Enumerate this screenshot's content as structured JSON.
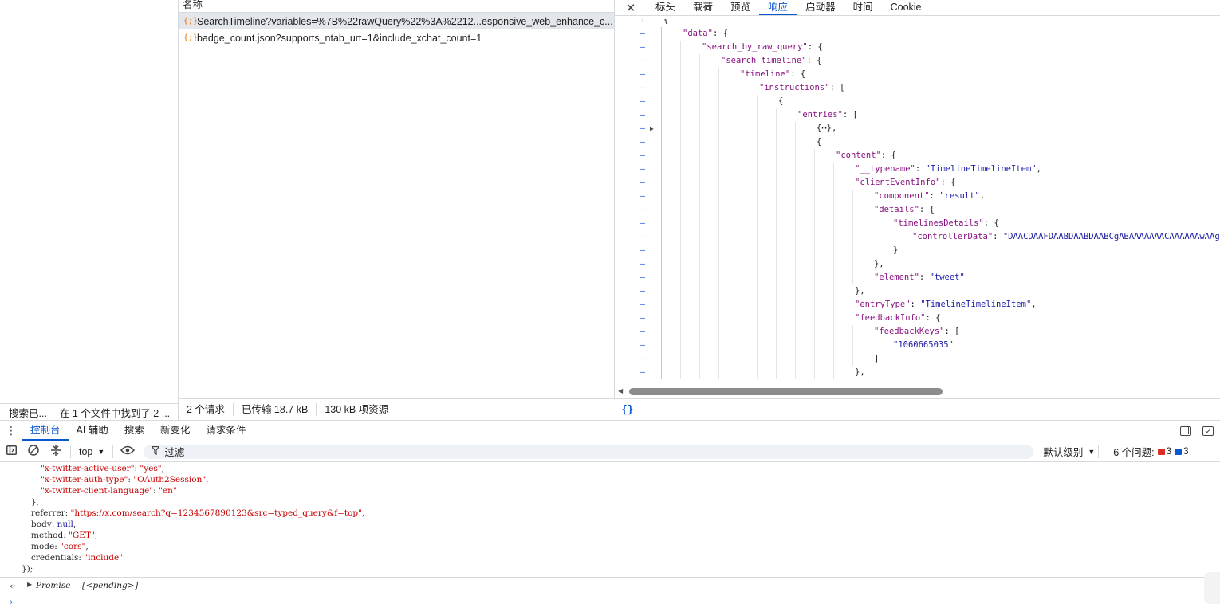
{
  "search_panel": {
    "status_left": "搜索已...",
    "status_right": "在 1 个文件中找到了 2 ..."
  },
  "network": {
    "column_name": "名称",
    "requests": [
      {
        "name": "SearchTimeline?variables=%7B%22rawQuery%22%3A%2212...esponsive_web_enhance_c...",
        "icon": "json-braces-icon",
        "selected": true
      },
      {
        "name": "badge_count.json?supports_ntab_urt=1&include_xchat_count=1",
        "icon": "json-braces-icon",
        "selected": false
      }
    ],
    "status": {
      "requests": "2 个请求",
      "transferred": "已传输 18.7 kB",
      "resources": "130 kB 项资源"
    }
  },
  "detail": {
    "close_label": "✕",
    "tabs": [
      "标头",
      "载荷",
      "预览",
      "响应",
      "启动器",
      "时间",
      "Cookie"
    ],
    "active_tab": "响应",
    "pretty_print_label": "{}",
    "lines": [
      {
        "num": "1",
        "indent": 0,
        "text": "{",
        "tokens": [
          {
            "t": "{",
            "c": "p"
          }
        ]
      },
      {
        "num": "–",
        "indent": 1,
        "tokens": [
          {
            "t": "\"data\"",
            "c": "k"
          },
          {
            "t": ": {",
            "c": "p"
          }
        ]
      },
      {
        "num": "–",
        "indent": 2,
        "tokens": [
          {
            "t": "\"search_by_raw_query\"",
            "c": "k"
          },
          {
            "t": ": {",
            "c": "p"
          }
        ]
      },
      {
        "num": "–",
        "indent": 3,
        "tokens": [
          {
            "t": "\"search_timeline\"",
            "c": "k"
          },
          {
            "t": ": {",
            "c": "p"
          }
        ]
      },
      {
        "num": "–",
        "indent": 4,
        "tokens": [
          {
            "t": "\"timeline\"",
            "c": "k"
          },
          {
            "t": ": {",
            "c": "p"
          }
        ]
      },
      {
        "num": "–",
        "indent": 5,
        "tokens": [
          {
            "t": "\"instructions\"",
            "c": "k"
          },
          {
            "t": ": [",
            "c": "p"
          }
        ]
      },
      {
        "num": "–",
        "indent": 6,
        "tokens": [
          {
            "t": "{",
            "c": "p"
          }
        ]
      },
      {
        "num": "–",
        "indent": 7,
        "tokens": [
          {
            "t": "\"entries\"",
            "c": "k"
          },
          {
            "t": ": [",
            "c": "p"
          }
        ]
      },
      {
        "num": "–",
        "indent": 8,
        "collapsed": true,
        "tokens": [
          {
            "t": "{⋯},",
            "c": "p"
          }
        ]
      },
      {
        "num": "–",
        "indent": 8,
        "tokens": [
          {
            "t": "{",
            "c": "p"
          }
        ]
      },
      {
        "num": "–",
        "indent": 9,
        "tokens": [
          {
            "t": "\"content\"",
            "c": "k"
          },
          {
            "t": ": {",
            "c": "p"
          }
        ]
      },
      {
        "num": "–",
        "indent": 10,
        "tokens": [
          {
            "t": "\"__typename\"",
            "c": "k"
          },
          {
            "t": ": ",
            "c": "p"
          },
          {
            "t": "\"TimelineTimelineItem\"",
            "c": "s"
          },
          {
            "t": ",",
            "c": "p"
          }
        ]
      },
      {
        "num": "–",
        "indent": 10,
        "tokens": [
          {
            "t": "\"clientEventInfo\"",
            "c": "k"
          },
          {
            "t": ": {",
            "c": "p"
          }
        ]
      },
      {
        "num": "–",
        "indent": 11,
        "tokens": [
          {
            "t": "\"component\"",
            "c": "k"
          },
          {
            "t": ": ",
            "c": "p"
          },
          {
            "t": "\"result\"",
            "c": "s"
          },
          {
            "t": ",",
            "c": "p"
          }
        ]
      },
      {
        "num": "–",
        "indent": 11,
        "tokens": [
          {
            "t": "\"details\"",
            "c": "k"
          },
          {
            "t": ": {",
            "c": "p"
          }
        ]
      },
      {
        "num": "–",
        "indent": 12,
        "tokens": [
          {
            "t": "\"timelinesDetails\"",
            "c": "k"
          },
          {
            "t": ": {",
            "c": "p"
          }
        ]
      },
      {
        "num": "–",
        "indent": 13,
        "tokens": [
          {
            "t": "\"controllerData\"",
            "c": "k"
          },
          {
            "t": ": ",
            "c": "p"
          },
          {
            "t": "\"DAACDAAFDAABDAABDAABCgABAAAAAAACAAAAAAwAAgoAAQ",
            "c": "s"
          }
        ]
      },
      {
        "num": "–",
        "indent": 12,
        "tokens": [
          {
            "t": "}",
            "c": "p"
          }
        ]
      },
      {
        "num": "–",
        "indent": 11,
        "tokens": [
          {
            "t": "},",
            "c": "p"
          }
        ]
      },
      {
        "num": "–",
        "indent": 11,
        "tokens": [
          {
            "t": "\"element\"",
            "c": "k"
          },
          {
            "t": ": ",
            "c": "p"
          },
          {
            "t": "\"tweet\"",
            "c": "s"
          }
        ]
      },
      {
        "num": "–",
        "indent": 10,
        "tokens": [
          {
            "t": "},",
            "c": "p"
          }
        ]
      },
      {
        "num": "–",
        "indent": 10,
        "tokens": [
          {
            "t": "\"entryType\"",
            "c": "k"
          },
          {
            "t": ": ",
            "c": "p"
          },
          {
            "t": "\"TimelineTimelineItem\"",
            "c": "s"
          },
          {
            "t": ",",
            "c": "p"
          }
        ]
      },
      {
        "num": "–",
        "indent": 10,
        "tokens": [
          {
            "t": "\"feedbackInfo\"",
            "c": "k"
          },
          {
            "t": ": {",
            "c": "p"
          }
        ]
      },
      {
        "num": "–",
        "indent": 11,
        "tokens": [
          {
            "t": "\"feedbackKeys\"",
            "c": "k"
          },
          {
            "t": ": [",
            "c": "p"
          }
        ]
      },
      {
        "num": "–",
        "indent": 12,
        "tokens": [
          {
            "t": "\"1060665035\"",
            "c": "s"
          }
        ]
      },
      {
        "num": "–",
        "indent": 11,
        "tokens": [
          {
            "t": "]",
            "c": "p"
          }
        ]
      },
      {
        "num": "–",
        "indent": 10,
        "tokens": [
          {
            "t": "},",
            "c": "p"
          }
        ]
      }
    ]
  },
  "drawer": {
    "tabs": [
      "控制台",
      "AI 辅助",
      "搜索",
      "新变化",
      "请求条件"
    ],
    "active_tab": "控制台",
    "context": "top",
    "filter_placeholder": "过滤",
    "levels": "默认级别",
    "issues_label": "6 个问题:",
    "errors": "3",
    "messages": "3"
  },
  "console": {
    "lines": [
      {
        "indent": 4,
        "tokens": [
          {
            "t": "\"x-twitter-active-user\"",
            "c": "cs"
          },
          {
            "t": ": ",
            "c": "ck"
          },
          {
            "t": "\"yes\"",
            "c": "cs"
          },
          {
            "t": ",",
            "c": "ck"
          }
        ]
      },
      {
        "indent": 4,
        "tokens": [
          {
            "t": "\"x-twitter-auth-type\"",
            "c": "cs"
          },
          {
            "t": ": ",
            "c": "ck"
          },
          {
            "t": "\"OAuth2Session\"",
            "c": "cs"
          },
          {
            "t": ",",
            "c": "ck"
          }
        ]
      },
      {
        "indent": 4,
        "tokens": [
          {
            "t": "\"x-twitter-client-language\"",
            "c": "cs"
          },
          {
            "t": ": ",
            "c": "ck"
          },
          {
            "t": "\"en\"",
            "c": "cs"
          }
        ]
      },
      {
        "indent": 2,
        "tokens": [
          {
            "t": "},",
            "c": "ck"
          }
        ]
      },
      {
        "indent": 2,
        "tokens": [
          {
            "t": "referrer: ",
            "c": "ck"
          },
          {
            "t": "\"https://x.com/search?q=1234567890123&src=typed_query&f=top\"",
            "c": "cs"
          },
          {
            "t": ",",
            "c": "ck"
          }
        ]
      },
      {
        "indent": 2,
        "tokens": [
          {
            "t": "body: ",
            "c": "ck"
          },
          {
            "t": "null",
            "c": "cn"
          },
          {
            "t": ",",
            "c": "ck"
          }
        ]
      },
      {
        "indent": 2,
        "tokens": [
          {
            "t": "method: ",
            "c": "ck"
          },
          {
            "t": "\"GET\"",
            "c": "cs"
          },
          {
            "t": ",",
            "c": "ck"
          }
        ]
      },
      {
        "indent": 2,
        "tokens": [
          {
            "t": "mode: ",
            "c": "ck"
          },
          {
            "t": "\"cors\"",
            "c": "cs"
          },
          {
            "t": ",",
            "c": "ck"
          }
        ]
      },
      {
        "indent": 2,
        "tokens": [
          {
            "t": "credentials: ",
            "c": "ck"
          },
          {
            "t": "\"include\"",
            "c": "cs"
          }
        ]
      },
      {
        "indent": 0,
        "tokens": [
          {
            "t": "});",
            "c": "ck"
          }
        ]
      }
    ],
    "result_prefix": "‹·",
    "result_label": "Promise",
    "result_value": "{<pending>}"
  }
}
